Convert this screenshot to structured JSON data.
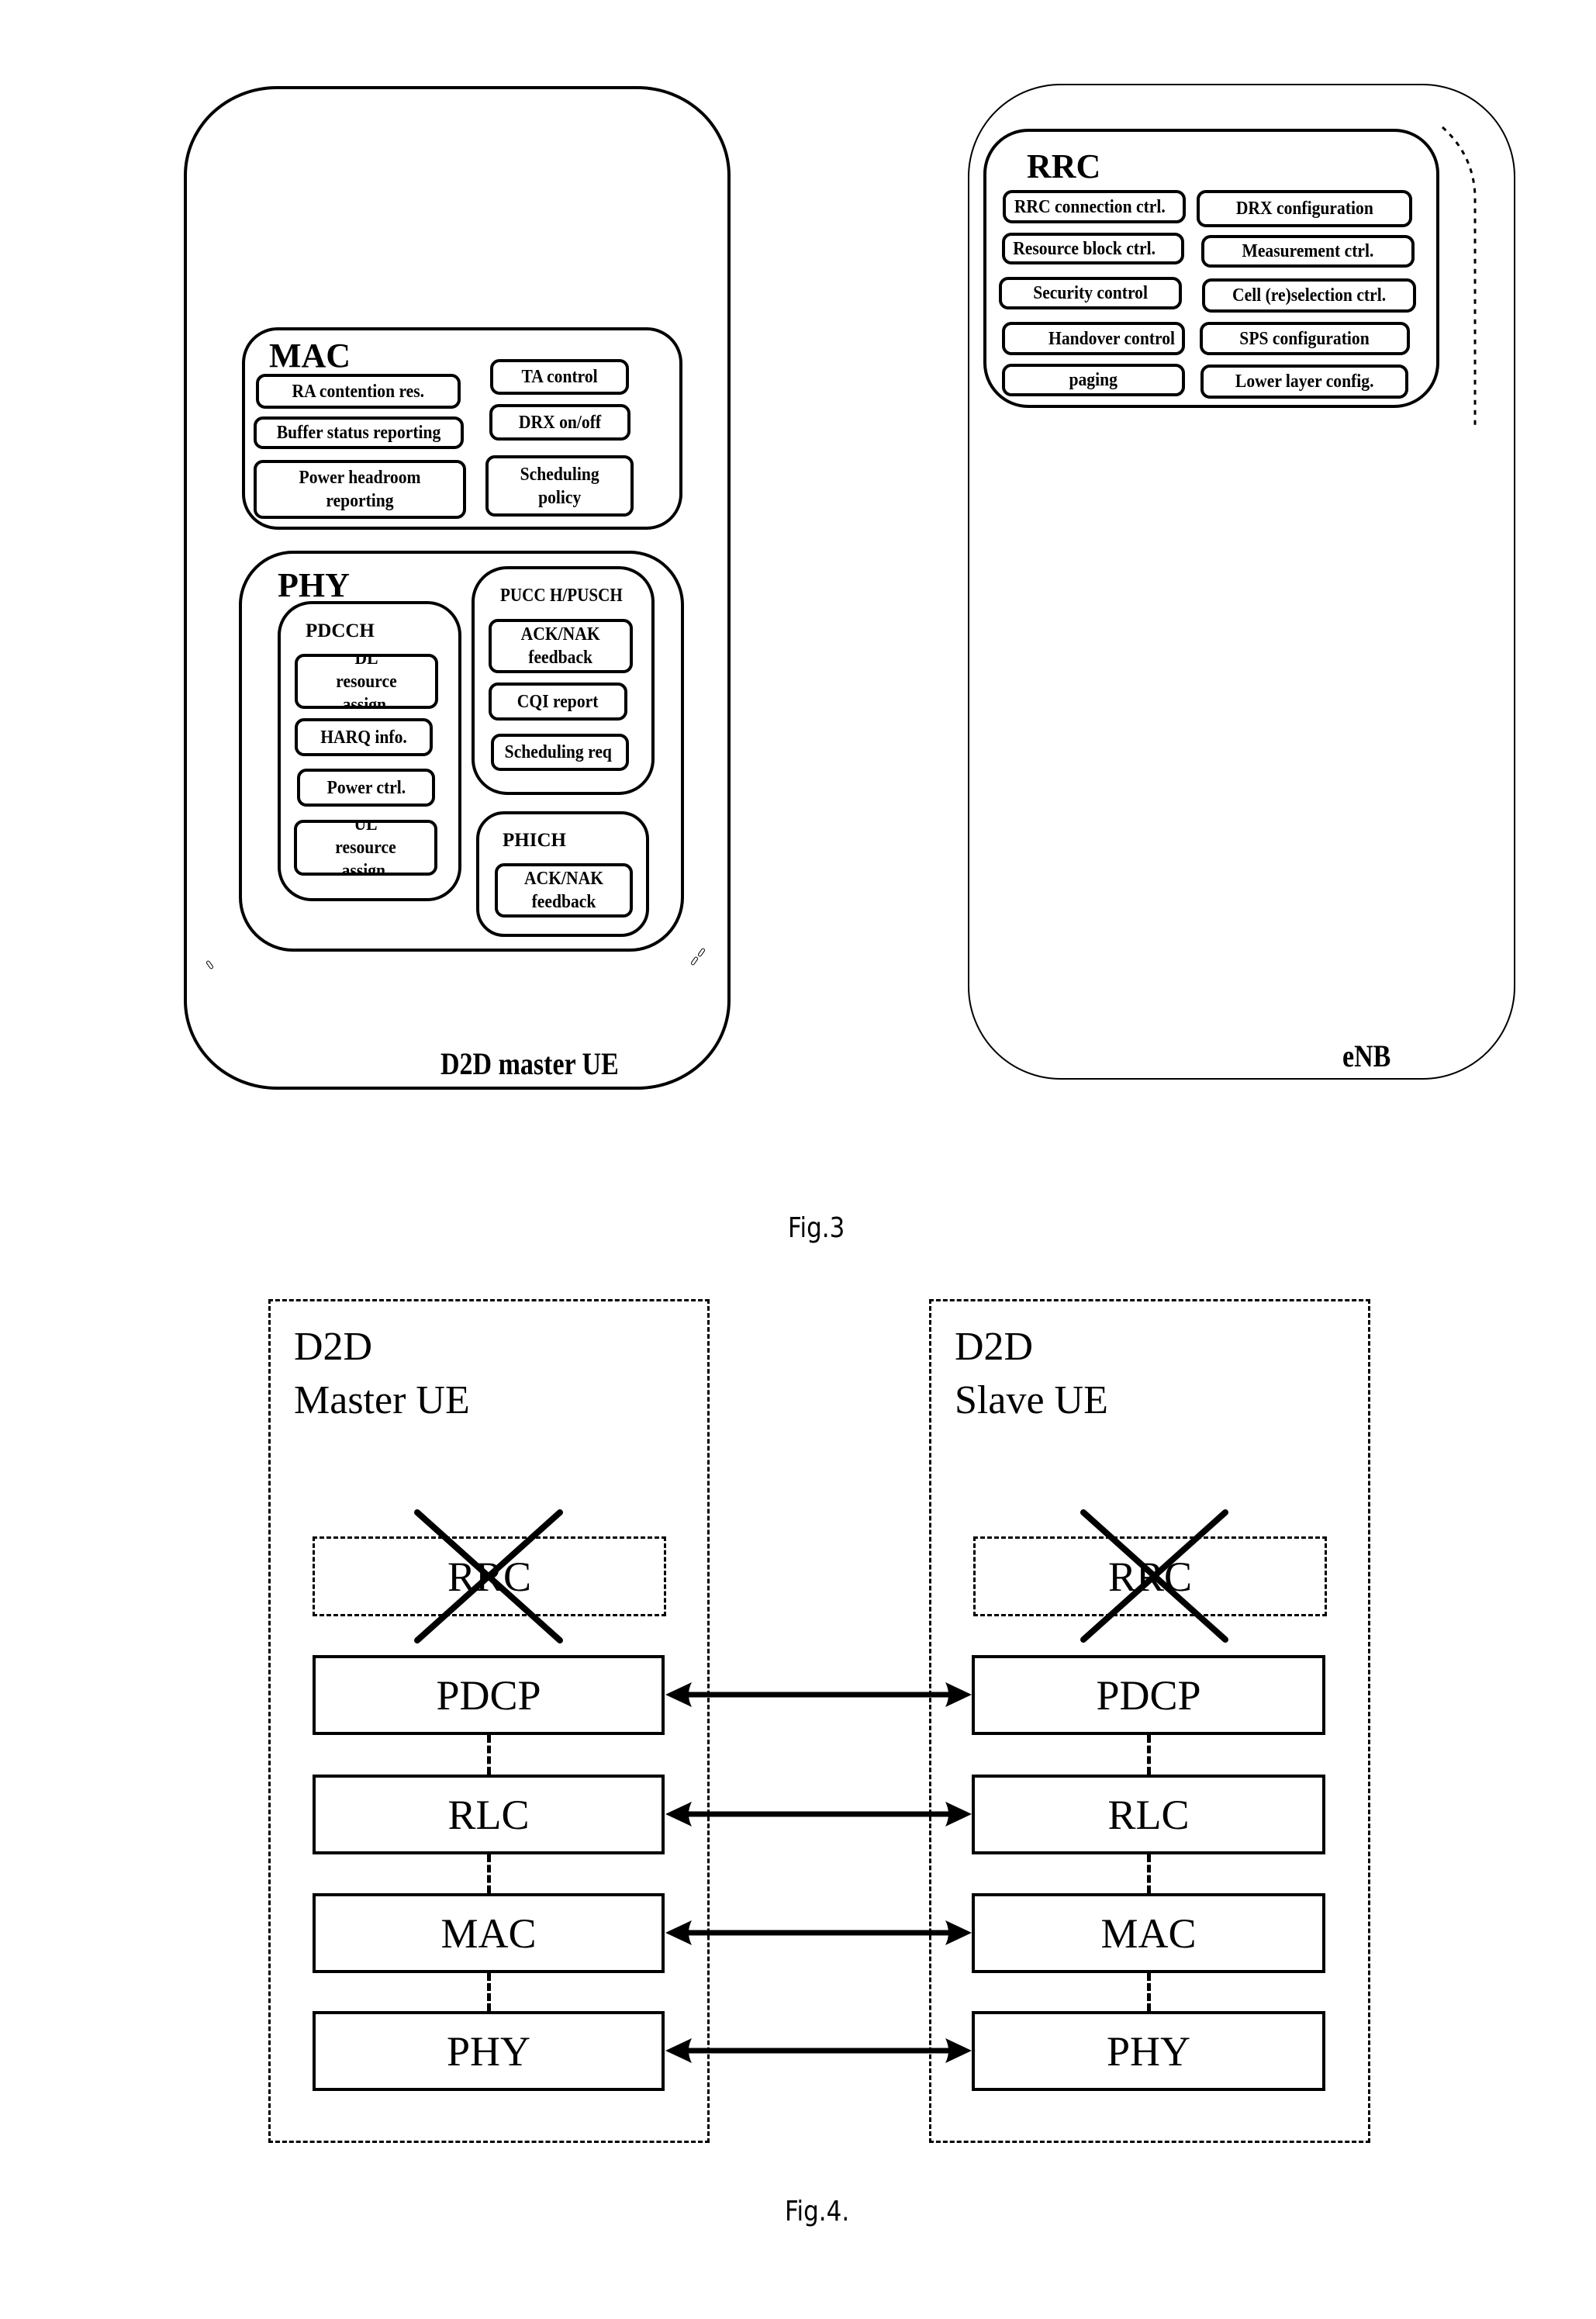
{
  "fig3": {
    "caption": "Fig.3",
    "ue": {
      "label": "D2D master UE",
      "mac": {
        "title": "MAC",
        "items": [
          "RA contention res.",
          "Buffer status reporting",
          "Power headroom reporting",
          "TA control",
          "DRX on/off",
          "Scheduling policy"
        ]
      },
      "phy": {
        "title": "PHY",
        "pdcch": {
          "title": "PDCCH",
          "items": [
            "DL resource assign.",
            "HARQ info.",
            "Power ctrl.",
            "UL resource assign."
          ]
        },
        "pucch_pusch": {
          "title": "PUCC H/PUSCH",
          "items": [
            "ACK/NAK feedback",
            "CQI report",
            "Scheduling req"
          ]
        },
        "phich": {
          "title": "PHICH",
          "items": [
            "ACK/NAK feedback"
          ]
        }
      }
    },
    "enb": {
      "label": "eNB",
      "rrc": {
        "title": "RRC",
        "items": [
          "RRC connection ctrl.",
          "DRX configuration",
          "Resource block ctrl.",
          "Measurement ctrl.",
          "Security control",
          "Cell (re)selection ctrl.",
          "Handover control",
          "SPS configuration",
          "paging",
          "Lower layer config."
        ]
      }
    }
  },
  "fig4": {
    "caption": "Fig.4.",
    "master": {
      "title_line1": "D2D",
      "title_line2": "Master UE",
      "disabled_layer": "RRC",
      "layers": [
        "PDCP",
        "RLC",
        "MAC",
        "PHY"
      ]
    },
    "slave": {
      "title_line1": "D2D",
      "title_line2": "Slave UE",
      "disabled_layer": "RRC",
      "layers": [
        "PDCP",
        "RLC",
        "MAC",
        "PHY"
      ]
    },
    "peer_links": [
      "PDCP",
      "RLC",
      "MAC",
      "PHY"
    ]
  }
}
